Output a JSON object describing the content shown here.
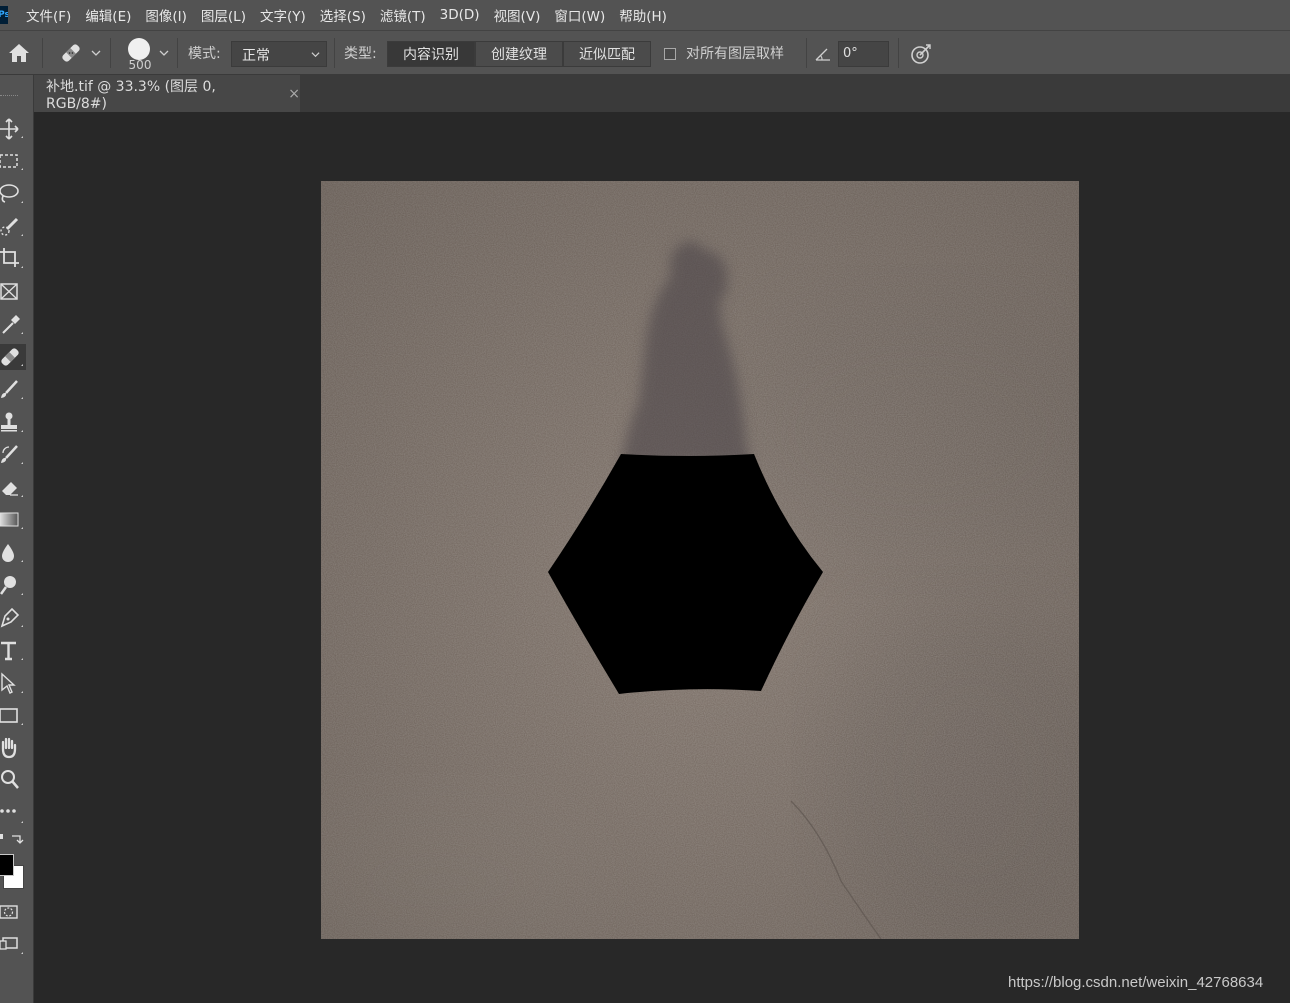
{
  "menu": {
    "logo": "Ps",
    "items": [
      "文件(F)",
      "编辑(E)",
      "图像(I)",
      "图层(L)",
      "文字(Y)",
      "选择(S)",
      "滤镜(T)",
      "3D(D)",
      "视图(V)",
      "窗口(W)",
      "帮助(H)"
    ]
  },
  "options": {
    "brush_size": "500",
    "mode_label": "模式:",
    "mode_value": "正常",
    "type_label": "类型:",
    "types": [
      "内容识别",
      "创建纹理",
      "近似匹配"
    ],
    "sample_all_label": "对所有图层取样",
    "sample_all_checked": false,
    "angle_value": "0°"
  },
  "document_tab": {
    "title": "补地.tif @ 33.3% (图层 0, RGB/8#)",
    "close": "×"
  },
  "tools": [
    "move-tool",
    "marquee-tool",
    "lasso-tool",
    "quick-select-tool",
    "crop-tool",
    "frame-tool",
    "eyedropper-tool",
    "healing-brush-tool",
    "brush-tool",
    "clone-stamp-tool",
    "history-brush-tool",
    "eraser-tool",
    "gradient-tool",
    "blur-tool",
    "dodge-tool",
    "pen-tool",
    "type-tool",
    "path-select-tool",
    "rectangle-tool",
    "hand-tool",
    "zoom-tool",
    "more-tools"
  ],
  "colors": {
    "foreground": "#000000",
    "background": "#ffffff",
    "ground": "#7a6d64"
  },
  "watermark": "https://blog.csdn.net/weixin_42768634"
}
